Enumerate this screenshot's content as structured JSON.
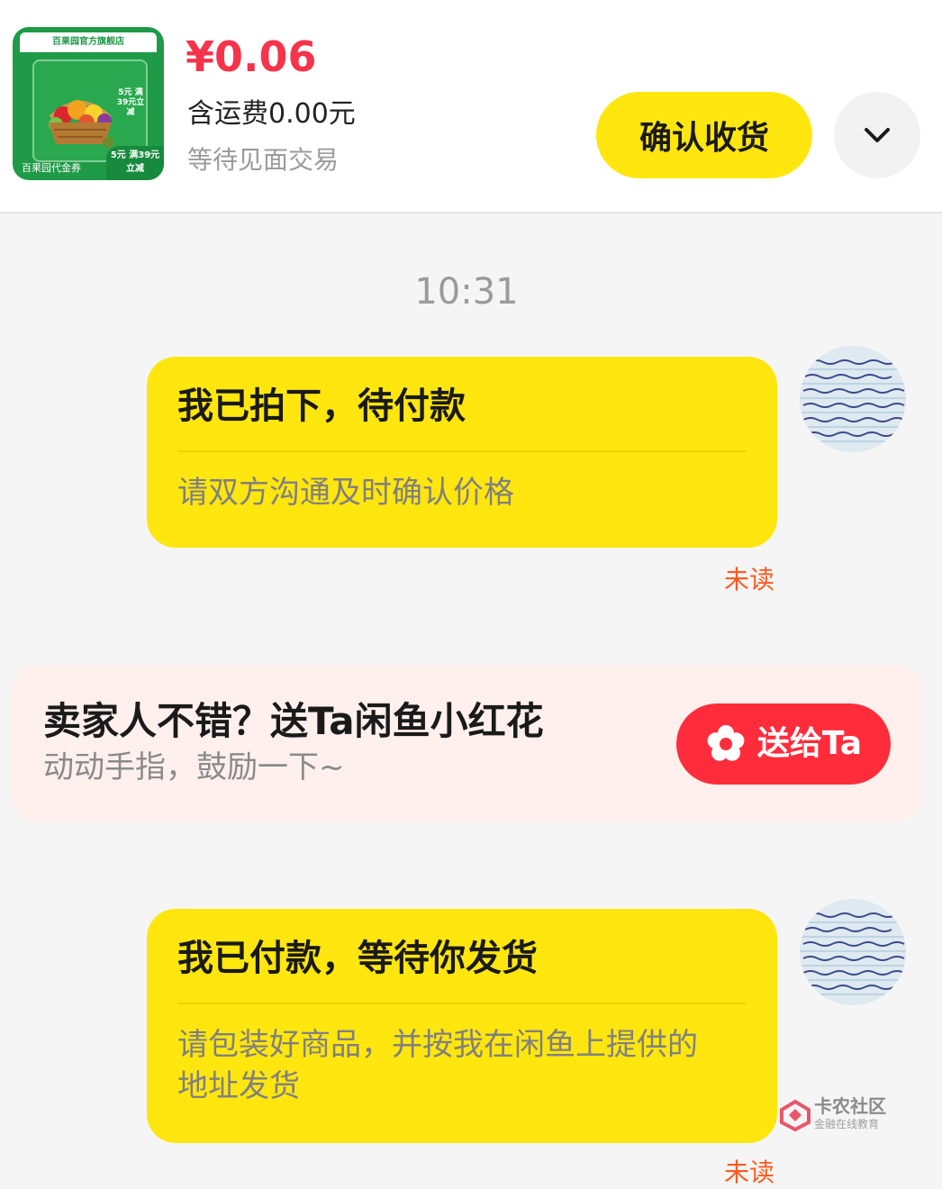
{
  "product": {
    "store_name": "百果园官方旗舰店",
    "promo_card": "5元 满39元立减",
    "voucher_name": "百果园代金券",
    "promo_corner": "5元 满39元立减",
    "price": "¥0.06",
    "shipping": "含运费0.00元",
    "status": "等待见面交易"
  },
  "actions": {
    "confirm_label": "确认收货",
    "more_icon": "chevron-down-icon"
  },
  "chat": {
    "timestamp": "10:31",
    "messages": [
      {
        "title": "我已拍下，待付款",
        "description": "请双方沟通及时确认价格",
        "read_status": "未读"
      },
      {
        "title": "我已付款，等待你发货",
        "description": "请包装好商品，并按我在闲鱼上提供的地址发货",
        "read_status": "未读"
      }
    ]
  },
  "flower_card": {
    "title": "卖家人不错？送Ta闲鱼小红花",
    "subtitle": "动动手指，鼓励一下~",
    "button_label": "送给Ta",
    "button_icon": "flower-icon"
  },
  "watermark": {
    "name": "卡农社区",
    "tagline": "金融在线教育"
  },
  "colors": {
    "accent_yellow": "#ffe60f",
    "price_red": "#f5334a",
    "gift_red": "#ff2d3c",
    "unread_orange": "#ff5a1f"
  }
}
